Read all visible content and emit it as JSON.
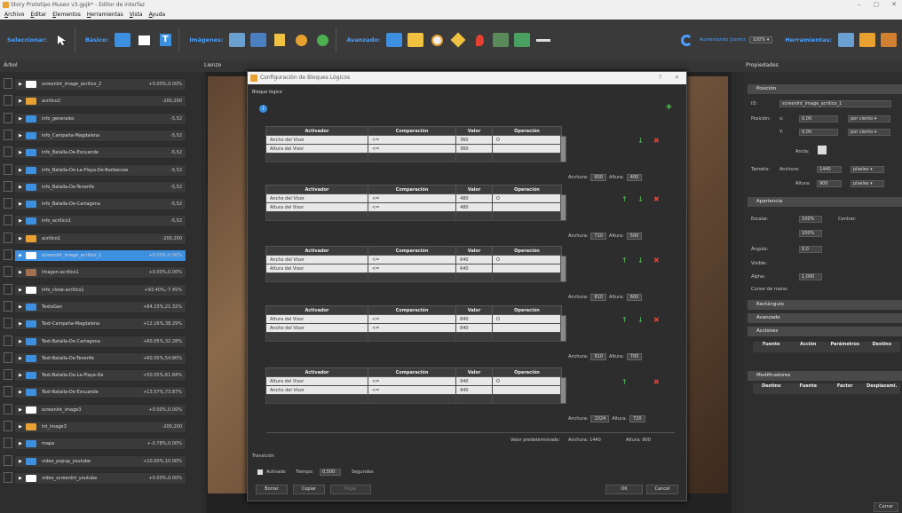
{
  "window": {
    "title": "Story Prototipo Museo v3.gpjk* - Editor de interfaz",
    "ctl_min": "–",
    "ctl_max": "▢",
    "ctl_close": "✕"
  },
  "menu": [
    "Archivo",
    "Editar",
    "Elementos",
    "Herramientas",
    "Vista",
    "Ayuda"
  ],
  "toolbar": {
    "select": "Seleccionar:",
    "basic": "Básico:",
    "images": "Imágenes:",
    "advanced": "Avanzado:",
    "zoom_label": "Aumentando (zoom):",
    "zoom": "100% ▾",
    "tools": "Herramientas:"
  },
  "panels": {
    "tree": "Árbol",
    "canvas": "Lienzo",
    "props": "Propiedades"
  },
  "tree": [
    {
      "name": "screenlnt_image_acrilico_2",
      "value": "+0.00%,0.00%",
      "thumb": "#ffffff",
      "sel": false
    },
    {
      "name": "acrilico2",
      "value": "-200,200",
      "thumb": "#e8a030",
      "sel": false
    },
    {
      "name": "info_generales",
      "value": "-5,52",
      "thumb": "#3d8fe0",
      "sel": false
    },
    {
      "name": "info_Campaña-Magdalena",
      "value": "-5,52",
      "thumb": "#3d8fe0",
      "sel": false
    },
    {
      "name": "info_Batalla-De-Escuande",
      "value": "-5,52",
      "thumb": "#3d8fe0",
      "sel": false
    },
    {
      "name": "info_Batalla-De-La-Playa-De-Barbacoas",
      "value": "-5,52",
      "thumb": "#3d8fe0",
      "sel": false
    },
    {
      "name": "info_Batalla-De-Tenerife",
      "value": "-5,52",
      "thumb": "#3d8fe0",
      "sel": false
    },
    {
      "name": "info_Batalla-De-Cartagena",
      "value": "-5,52",
      "thumb": "#3d8fe0",
      "sel": false
    },
    {
      "name": "info_acrilico1",
      "value": "-5,52",
      "thumb": "#3d8fe0",
      "sel": false
    },
    {
      "name": "acrilico1",
      "value": "-200,200",
      "thumb": "#e8a030",
      "sel": false
    },
    {
      "name": "screenlnt_image_acrilico_1",
      "value": "+0.00%,0.00%",
      "thumb": "#ffffff",
      "sel": true
    },
    {
      "name": "Imagen-acrilico1",
      "value": "+0.00%,0.00%",
      "thumb": "#a07050",
      "sel": false
    },
    {
      "name": "info_close-acrilico1",
      "value": "+93.40%,-7.45%",
      "thumb": "#ffffff",
      "sel": false
    },
    {
      "name": "TextoGen",
      "value": "+84.23%,21.32%",
      "thumb": "#3d8fe0",
      "sel": false
    },
    {
      "name": "Text-Campaña-Magdalena",
      "value": "+12.16%,38.29%",
      "thumb": "#3d8fe0",
      "sel": false
    },
    {
      "name": "Text-Batalla-De-Cartagena",
      "value": "+60.05%,32.28%",
      "thumb": "#3d8fe0",
      "sel": false
    },
    {
      "name": "Text-Batalla-De-Tenerife",
      "value": "+60.05%,54.80%",
      "thumb": "#3d8fe0",
      "sel": false
    },
    {
      "name": "Text-Batalla-De-La-Playa-De",
      "value": "+50.05%,61.84%",
      "thumb": "#3d8fe0",
      "sel": false
    },
    {
      "name": "Text-Batalla-De-Escuande",
      "value": "+13.57%,73.87%",
      "thumb": "#3d8fe0",
      "sel": false
    },
    {
      "name": "screenlnt_image3",
      "value": "+0.00%,0.00%",
      "thumb": "#ffffff",
      "sel": false
    },
    {
      "name": "int_image3",
      "value": "-200,200",
      "thumb": "#e8a030",
      "sel": false
    },
    {
      "name": "mapa",
      "value": "+-0.78%,0.00%",
      "thumb": "#3d8fe0",
      "sel": false
    },
    {
      "name": "video_popup_youtube",
      "value": "+10.00%,10.00%",
      "thumb": "#3d8fe0",
      "sel": false
    },
    {
      "name": "video_screenlnt_youtube",
      "value": "+0.00%,0.00%",
      "thumb": "#ffffff",
      "sel": false
    }
  ],
  "dialog": {
    "title": "Configuración de Bloques Lógicos",
    "help": "?",
    "close": "✕",
    "section": "Bloque lógico",
    "cols": [
      "Activador",
      "Comparación",
      "Valor",
      "Operación"
    ],
    "blocks": [
      {
        "rows": [
          [
            "Ancho del Visor",
            "<=",
            "360",
            "O"
          ],
          [
            "Altura del Visor",
            "<=",
            "360",
            ""
          ]
        ],
        "w": "600",
        "h": "400"
      },
      {
        "rows": [
          [
            "Ancho del Visor",
            "<=",
            "480",
            "O"
          ],
          [
            "Altura del Visor",
            "<=",
            "480",
            ""
          ]
        ],
        "w": "710",
        "h": "500"
      },
      {
        "rows": [
          [
            "Ancho del Visor",
            "<=",
            "640",
            "O"
          ],
          [
            "Altura del Visor",
            "<=",
            "640",
            ""
          ]
        ],
        "w": "810",
        "h": "600"
      },
      {
        "rows": [
          [
            "Altura del Visor",
            "<=",
            "840",
            "O"
          ],
          [
            "Ancho del Visor",
            "<=",
            "840",
            ""
          ]
        ],
        "w": "910",
        "h": "700"
      },
      {
        "rows": [
          [
            "Altura del Visor",
            "<=",
            "940",
            "O"
          ],
          [
            "Ancho del Visor",
            "<=",
            "940",
            ""
          ]
        ],
        "w": "1024",
        "h": "720"
      }
    ],
    "w_label": "Anchura:",
    "h_label": "Altura:",
    "default_label": "Valor predeterminado:",
    "default_w": "Anchura: 1440",
    "default_h": "Altura: 900",
    "transition": "Transición",
    "activated": "Activado",
    "time_label": "Tiempo:",
    "time_value": "0,500",
    "seconds": "Segundos",
    "btn_delete": "Borrar",
    "btn_copy": "Copiar",
    "btn_paste": "Pegar",
    "btn_ok": "OK",
    "btn_cancel": "Cancel"
  },
  "props": {
    "position": "Posición",
    "id_label": "ID:",
    "id_value": "screenlnt_image_acrilico_1",
    "pos_label": "Posición:",
    "x_label": "x:",
    "x_value": "0,00",
    "y_label": "Y:",
    "y_value": "0,00",
    "unit": "por ciento ▾",
    "anchor": "Ancla:",
    "size_label": "Tamaño:",
    "width_label": "Anchura:",
    "width_value": "1440",
    "height_label": "Altura:",
    "height_value": "900",
    "px": "píxeles ▾",
    "appearance": "Apariencia",
    "scale_label": "Escalar:",
    "scale_x": "100%",
    "scale_y": "100%",
    "center": "Centrar:",
    "angle": "Ángulo:",
    "angle_v": "0,0",
    "visible": "Visible:",
    "alpha": "Alpha:",
    "alpha_v": "1,000",
    "cursor": "Cursor de mano:",
    "rect": "Rectángulo",
    "adv": "Avanzado",
    "actions": "Acciones",
    "act_cols": [
      "Fuente",
      "Acción",
      "Parámetros",
      "Destino"
    ],
    "mods": "Modificadores",
    "mod_cols": [
      "Destino",
      "Fuente",
      "Factor",
      "Desplazami."
    ],
    "close_btn": "Cerrar"
  }
}
